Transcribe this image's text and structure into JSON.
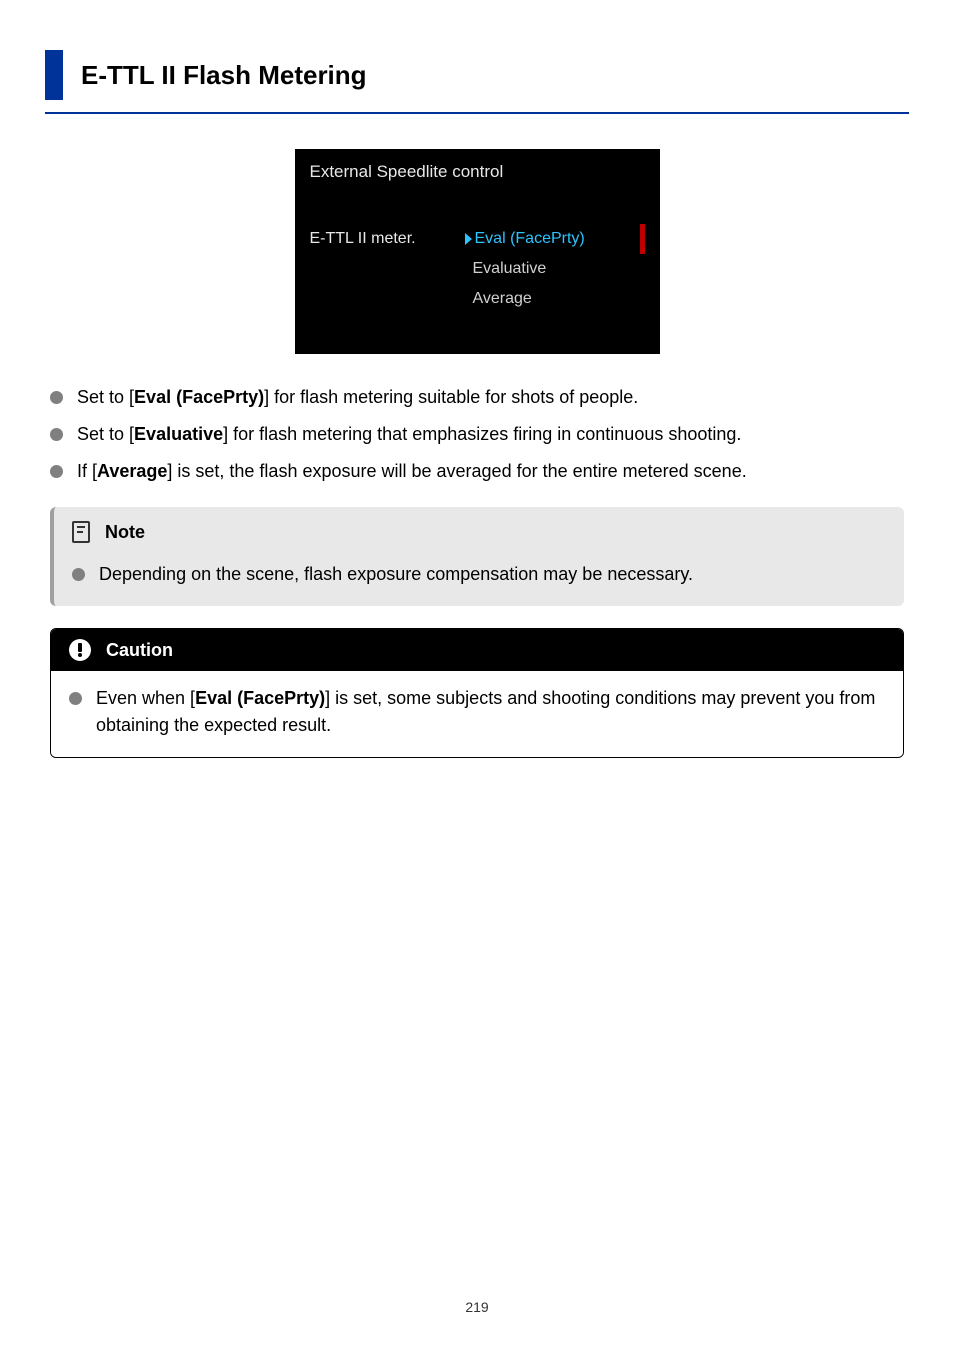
{
  "heading": "E-TTL II Flash Metering",
  "camera_screen": {
    "title": "External Speedlite control",
    "label": "E-TTL II meter.",
    "selected": "Eval (FacePrty)",
    "options": [
      "Evaluative",
      "Average"
    ]
  },
  "bullets": [
    {
      "pre": "Set to [",
      "bold": "Eval (FacePrty)",
      "post": "] for flash metering suitable for shots of people."
    },
    {
      "pre": "Set to [",
      "bold": "Evaluative",
      "post": "] for flash metering that emphasizes firing in continuous shooting."
    },
    {
      "pre": "If [",
      "bold": "Average",
      "post": "] is set, the flash exposure will be averaged for the entire metered scene."
    }
  ],
  "note": {
    "title": "Note",
    "body": "Depending on the scene, flash exposure compensation may be necessary."
  },
  "caution": {
    "title": "Caution",
    "body_pre": "Even when [",
    "body_bold": "Eval (FacePrty)",
    "body_post": "] is set, some subjects and shooting conditions may prevent you from obtaining the expected result."
  },
  "page_number": "219"
}
